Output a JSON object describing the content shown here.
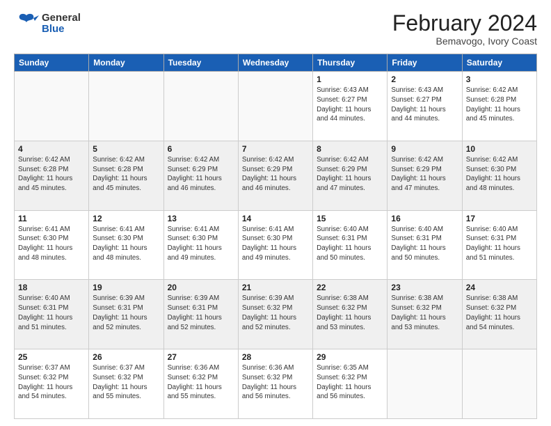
{
  "header": {
    "logo_general": "General",
    "logo_blue": "Blue",
    "month_title": "February 2024",
    "location": "Bemavogo, Ivory Coast"
  },
  "days_of_week": [
    "Sunday",
    "Monday",
    "Tuesday",
    "Wednesday",
    "Thursday",
    "Friday",
    "Saturday"
  ],
  "weeks": [
    [
      {
        "day": "",
        "info": ""
      },
      {
        "day": "",
        "info": ""
      },
      {
        "day": "",
        "info": ""
      },
      {
        "day": "",
        "info": ""
      },
      {
        "day": "1",
        "info": "Sunrise: 6:43 AM\nSunset: 6:27 PM\nDaylight: 11 hours\nand 44 minutes."
      },
      {
        "day": "2",
        "info": "Sunrise: 6:43 AM\nSunset: 6:27 PM\nDaylight: 11 hours\nand 44 minutes."
      },
      {
        "day": "3",
        "info": "Sunrise: 6:42 AM\nSunset: 6:28 PM\nDaylight: 11 hours\nand 45 minutes."
      }
    ],
    [
      {
        "day": "4",
        "info": "Sunrise: 6:42 AM\nSunset: 6:28 PM\nDaylight: 11 hours\nand 45 minutes."
      },
      {
        "day": "5",
        "info": "Sunrise: 6:42 AM\nSunset: 6:28 PM\nDaylight: 11 hours\nand 45 minutes."
      },
      {
        "day": "6",
        "info": "Sunrise: 6:42 AM\nSunset: 6:29 PM\nDaylight: 11 hours\nand 46 minutes."
      },
      {
        "day": "7",
        "info": "Sunrise: 6:42 AM\nSunset: 6:29 PM\nDaylight: 11 hours\nand 46 minutes."
      },
      {
        "day": "8",
        "info": "Sunrise: 6:42 AM\nSunset: 6:29 PM\nDaylight: 11 hours\nand 47 minutes."
      },
      {
        "day": "9",
        "info": "Sunrise: 6:42 AM\nSunset: 6:29 PM\nDaylight: 11 hours\nand 47 minutes."
      },
      {
        "day": "10",
        "info": "Sunrise: 6:42 AM\nSunset: 6:30 PM\nDaylight: 11 hours\nand 48 minutes."
      }
    ],
    [
      {
        "day": "11",
        "info": "Sunrise: 6:41 AM\nSunset: 6:30 PM\nDaylight: 11 hours\nand 48 minutes."
      },
      {
        "day": "12",
        "info": "Sunrise: 6:41 AM\nSunset: 6:30 PM\nDaylight: 11 hours\nand 48 minutes."
      },
      {
        "day": "13",
        "info": "Sunrise: 6:41 AM\nSunset: 6:30 PM\nDaylight: 11 hours\nand 49 minutes."
      },
      {
        "day": "14",
        "info": "Sunrise: 6:41 AM\nSunset: 6:30 PM\nDaylight: 11 hours\nand 49 minutes."
      },
      {
        "day": "15",
        "info": "Sunrise: 6:40 AM\nSunset: 6:31 PM\nDaylight: 11 hours\nand 50 minutes."
      },
      {
        "day": "16",
        "info": "Sunrise: 6:40 AM\nSunset: 6:31 PM\nDaylight: 11 hours\nand 50 minutes."
      },
      {
        "day": "17",
        "info": "Sunrise: 6:40 AM\nSunset: 6:31 PM\nDaylight: 11 hours\nand 51 minutes."
      }
    ],
    [
      {
        "day": "18",
        "info": "Sunrise: 6:40 AM\nSunset: 6:31 PM\nDaylight: 11 hours\nand 51 minutes."
      },
      {
        "day": "19",
        "info": "Sunrise: 6:39 AM\nSunset: 6:31 PM\nDaylight: 11 hours\nand 52 minutes."
      },
      {
        "day": "20",
        "info": "Sunrise: 6:39 AM\nSunset: 6:31 PM\nDaylight: 11 hours\nand 52 minutes."
      },
      {
        "day": "21",
        "info": "Sunrise: 6:39 AM\nSunset: 6:32 PM\nDaylight: 11 hours\nand 52 minutes."
      },
      {
        "day": "22",
        "info": "Sunrise: 6:38 AM\nSunset: 6:32 PM\nDaylight: 11 hours\nand 53 minutes."
      },
      {
        "day": "23",
        "info": "Sunrise: 6:38 AM\nSunset: 6:32 PM\nDaylight: 11 hours\nand 53 minutes."
      },
      {
        "day": "24",
        "info": "Sunrise: 6:38 AM\nSunset: 6:32 PM\nDaylight: 11 hours\nand 54 minutes."
      }
    ],
    [
      {
        "day": "25",
        "info": "Sunrise: 6:37 AM\nSunset: 6:32 PM\nDaylight: 11 hours\nand 54 minutes."
      },
      {
        "day": "26",
        "info": "Sunrise: 6:37 AM\nSunset: 6:32 PM\nDaylight: 11 hours\nand 55 minutes."
      },
      {
        "day": "27",
        "info": "Sunrise: 6:36 AM\nSunset: 6:32 PM\nDaylight: 11 hours\nand 55 minutes."
      },
      {
        "day": "28",
        "info": "Sunrise: 6:36 AM\nSunset: 6:32 PM\nDaylight: 11 hours\nand 56 minutes."
      },
      {
        "day": "29",
        "info": "Sunrise: 6:35 AM\nSunset: 6:32 PM\nDaylight: 11 hours\nand 56 minutes."
      },
      {
        "day": "",
        "info": ""
      },
      {
        "day": "",
        "info": ""
      }
    ]
  ]
}
